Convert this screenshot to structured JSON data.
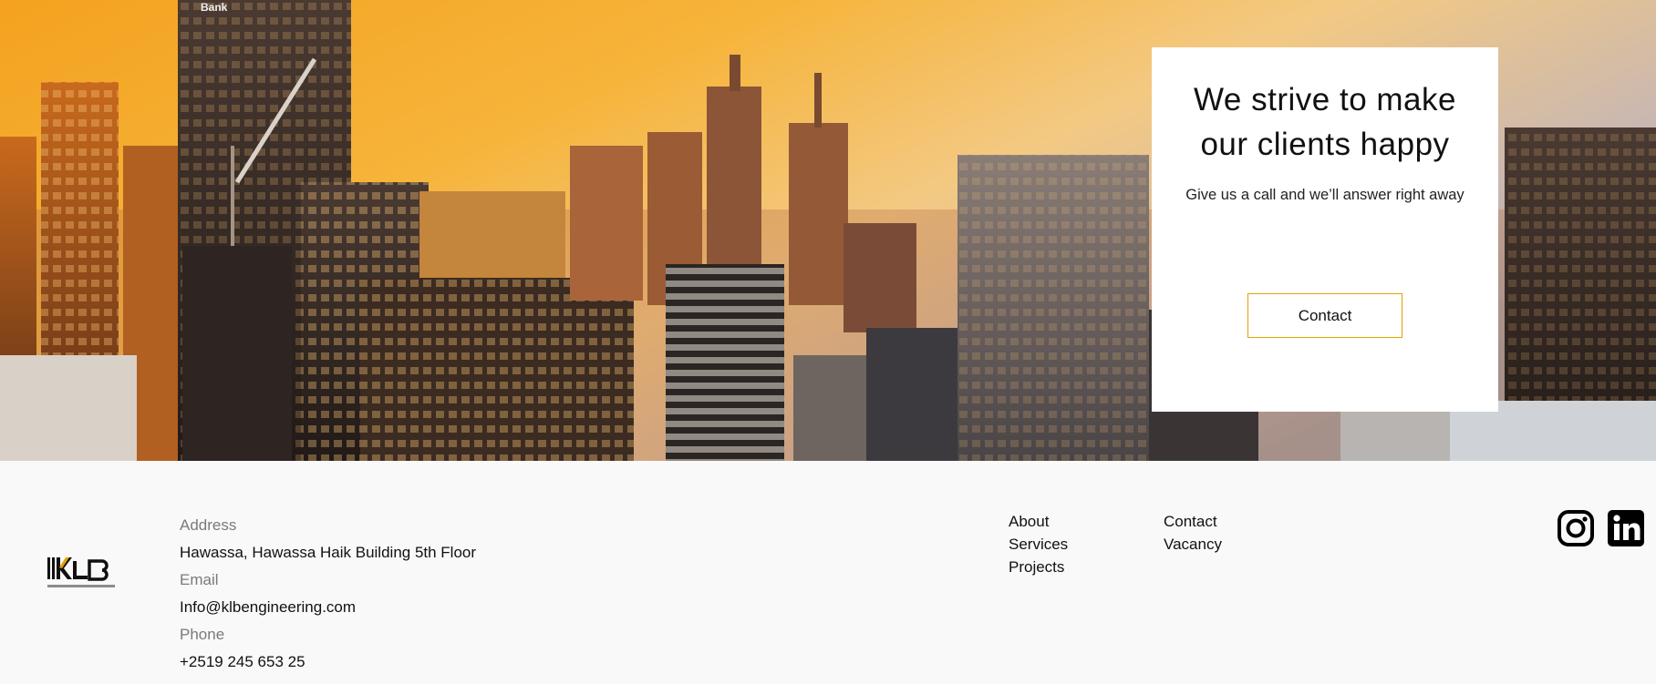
{
  "hero": {
    "image_alt": "City skyline at sunset",
    "card": {
      "title": "We strive to make our clients happy",
      "subtitle": "Give us a call and we’ll answer right away",
      "button_label": "Contact"
    }
  },
  "footer": {
    "logo_name": "klb-engineering-logo",
    "address_label": "Address",
    "address_value": "Hawassa, Hawassa Haik Building 5th Floor",
    "email_label": "Email",
    "email_value": "Info@klbengineering.com",
    "phone_label": "Phone",
    "phone_value": "+2519 245 653 25",
    "nav_col_1": [
      "About",
      "Services",
      "Projects"
    ],
    "nav_col_2": [
      "Contact",
      "Vacancy"
    ],
    "social": [
      "instagram-icon",
      "linkedin-icon"
    ]
  },
  "colors": {
    "accent": "#e6a100",
    "footer_bg": "#f9f9f9",
    "label_gray": "#7a7a7a"
  }
}
